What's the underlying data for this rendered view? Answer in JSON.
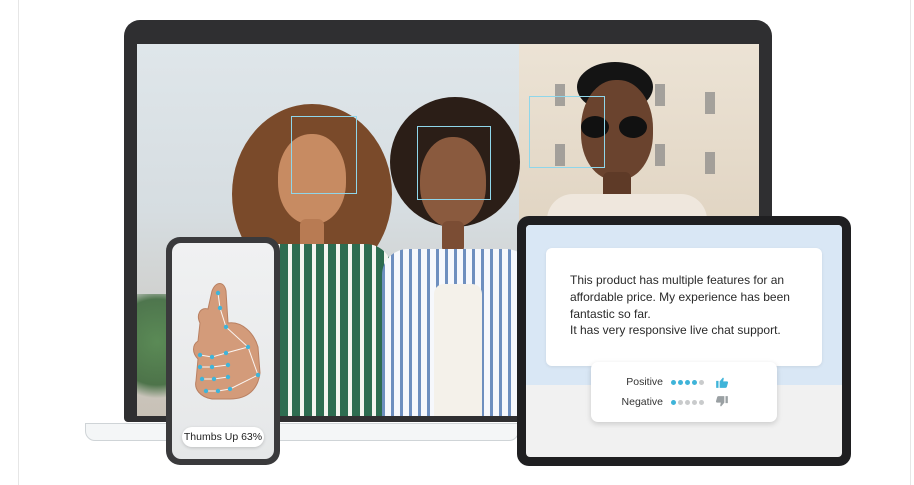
{
  "phone": {
    "gesture_label": "Thumbs Up 63%"
  },
  "tablet": {
    "review_lines": [
      "This product has multiple features for an",
      "affordable price. My experience has been",
      "fantastic so far.",
      "It has very responsive live chat support."
    ],
    "sentiment": {
      "positive_label": "Positive",
      "negative_label": "Negative",
      "positive_score_dots": 4,
      "negative_score_dots": 1,
      "max_dots": 5
    }
  },
  "colors": {
    "accent": "#3fb4d9",
    "face_box": "#8fd6ea",
    "tablet_top": "#d9e7f5",
    "device_dark": "#2f2f31"
  },
  "icons": {
    "positive": "thumbs-up-icon",
    "negative": "thumbs-down-icon"
  }
}
